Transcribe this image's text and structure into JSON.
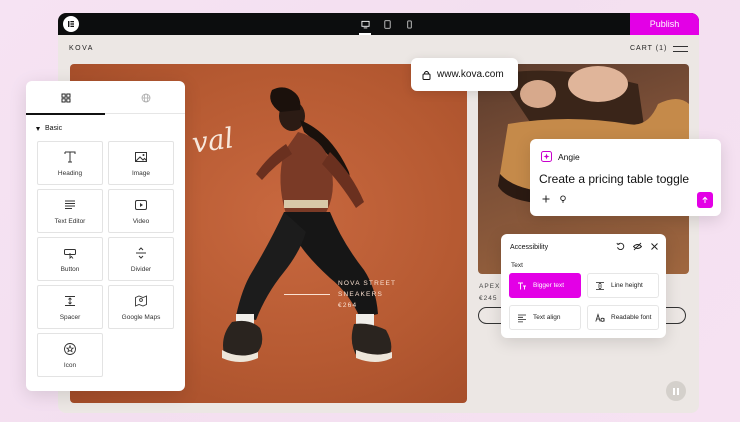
{
  "topbar": {
    "publish_label": "Publish",
    "logo": "elementor-logo-icon",
    "devices": [
      "desktop-icon",
      "tablet-icon",
      "mobile-icon"
    ]
  },
  "site": {
    "brand": "KOVA",
    "cart": "CART (1)",
    "hero_script": "val",
    "hero_caption": [
      "NOVA STREET",
      "SNEAKERS",
      "€264"
    ],
    "product_caption": [
      "APEX",
      "€245"
    ]
  },
  "url_pill": {
    "url": "www.kova.com"
  },
  "widgets": {
    "section": "Basic",
    "items": [
      {
        "label": "Heading",
        "icon": "heading-icon"
      },
      {
        "label": "Image",
        "icon": "image-icon"
      },
      {
        "label": "Text Editor",
        "icon": "text-editor-icon"
      },
      {
        "label": "Video",
        "icon": "video-icon"
      },
      {
        "label": "Button",
        "icon": "button-icon"
      },
      {
        "label": "Divider",
        "icon": "divider-icon"
      },
      {
        "label": "Spacer",
        "icon": "spacer-icon"
      },
      {
        "label": "Google Maps",
        "icon": "map-icon"
      },
      {
        "label": "Icon",
        "icon": "star-icon"
      }
    ]
  },
  "angie": {
    "name": "Angie",
    "prompt": "Create a pricing table toggle"
  },
  "accessibility": {
    "title": "Accessibility",
    "section": "Text",
    "options": [
      {
        "label": "Bigger text",
        "active": true
      },
      {
        "label": "Line height",
        "active": false
      },
      {
        "label": "Text align",
        "active": false
      },
      {
        "label": "Readable font",
        "active": false
      }
    ]
  },
  "colors": {
    "accent": "#e300e6",
    "hero_bg": "#b65a32",
    "topbar": "#0c0d0e"
  }
}
